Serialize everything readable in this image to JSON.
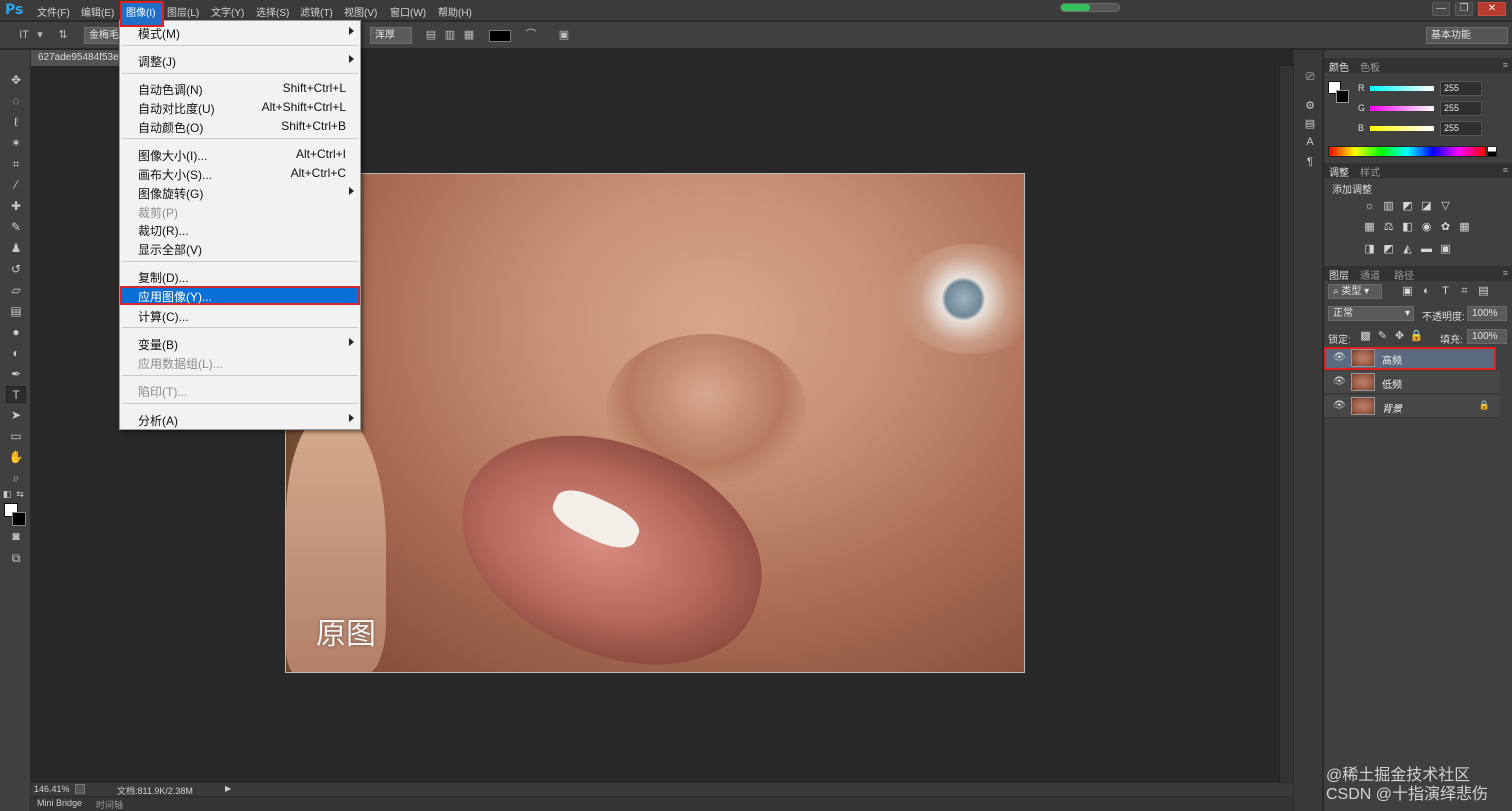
{
  "app": {
    "logo": "Ps"
  },
  "menubar": {
    "items": [
      "文件(F)",
      "编辑(E)",
      "图像(I)",
      "图层(L)",
      "文字(Y)",
      "选择(S)",
      "滤镜(T)",
      "视图(V)",
      "窗口(W)",
      "帮助(H)"
    ],
    "active": "图像(I)",
    "loading_progress": 0.5
  },
  "window_controls": {
    "minimize": "—",
    "restore": "❐",
    "close": "✕"
  },
  "options_bar": {
    "font_field": "金梅毛",
    "antialias": "浑厚",
    "workspace": "基本功能"
  },
  "document": {
    "tab_title": "627ade95484f53e",
    "image_caption": "原图",
    "zoom": "146.41%",
    "doc_info": "文档:811.9K/2.38M"
  },
  "bottom_tabs": [
    "Mini Bridge",
    "时间轴"
  ],
  "dropdown": {
    "items": [
      {
        "label": "模式(M)",
        "shortcut": "",
        "submenu": true,
        "disabled": false
      },
      {
        "label": "调整(J)",
        "shortcut": "",
        "submenu": true,
        "disabled": false
      },
      {
        "label": "自动色调(N)",
        "shortcut": "Shift+Ctrl+L",
        "submenu": false,
        "disabled": false
      },
      {
        "label": "自动对比度(U)",
        "shortcut": "Alt+Shift+Ctrl+L",
        "submenu": false,
        "disabled": false
      },
      {
        "label": "自动颜色(O)",
        "shortcut": "Shift+Ctrl+B",
        "submenu": false,
        "disabled": false
      },
      {
        "label": "图像大小(I)...",
        "shortcut": "Alt+Ctrl+I",
        "submenu": false,
        "disabled": false
      },
      {
        "label": "画布大小(S)...",
        "shortcut": "Alt+Ctrl+C",
        "submenu": false,
        "disabled": false
      },
      {
        "label": "图像旋转(G)",
        "shortcut": "",
        "submenu": true,
        "disabled": false
      },
      {
        "label": "裁剪(P)",
        "shortcut": "",
        "submenu": false,
        "disabled": true
      },
      {
        "label": "裁切(R)...",
        "shortcut": "",
        "submenu": false,
        "disabled": false
      },
      {
        "label": "显示全部(V)",
        "shortcut": "",
        "submenu": false,
        "disabled": false
      },
      {
        "label": "复制(D)...",
        "shortcut": "",
        "submenu": false,
        "disabled": false
      },
      {
        "label": "应用图像(Y)...",
        "shortcut": "",
        "submenu": false,
        "disabled": false,
        "selected": true
      },
      {
        "label": "计算(C)...",
        "shortcut": "",
        "submenu": false,
        "disabled": false
      },
      {
        "label": "变量(B)",
        "shortcut": "",
        "submenu": true,
        "disabled": false
      },
      {
        "label": "应用数据组(L)...",
        "shortcut": "",
        "submenu": false,
        "disabled": true
      },
      {
        "label": "陷印(T)...",
        "shortcut": "",
        "submenu": false,
        "disabled": true
      },
      {
        "label": "分析(A)",
        "shortcut": "",
        "submenu": true,
        "disabled": false
      }
    ]
  },
  "color_panel": {
    "tabs": [
      "颜色",
      "色板"
    ],
    "channels": [
      {
        "label": "R",
        "value": "255"
      },
      {
        "label": "G",
        "value": "255"
      },
      {
        "label": "B",
        "value": "255"
      }
    ]
  },
  "adjustments_panel": {
    "tabs": [
      "调整",
      "样式"
    ],
    "title": "添加调整"
  },
  "layers_panel": {
    "tabs": [
      "图层",
      "通道",
      "路径"
    ],
    "filter_kind": "类型",
    "blend_mode": "正常",
    "opacity_label": "不透明度:",
    "opacity": "100%",
    "lock_label": "锁定:",
    "fill_label": "填充:",
    "fill": "100%",
    "layers": [
      {
        "name": "高频",
        "selected": true,
        "locked": false,
        "italic": false
      },
      {
        "name": "低频",
        "selected": false,
        "locked": false,
        "italic": false
      },
      {
        "name": "背景",
        "selected": false,
        "locked": true,
        "italic": true
      }
    ]
  },
  "watermark": {
    "line1": "@稀土掘金技术社区",
    "line2": "CSDN @十指演绎悲伤"
  },
  "colors": {
    "menu_highlight": "#0a6fd6",
    "annotation_red": "#e0201f",
    "ps_blue": "#2fa5e8"
  }
}
